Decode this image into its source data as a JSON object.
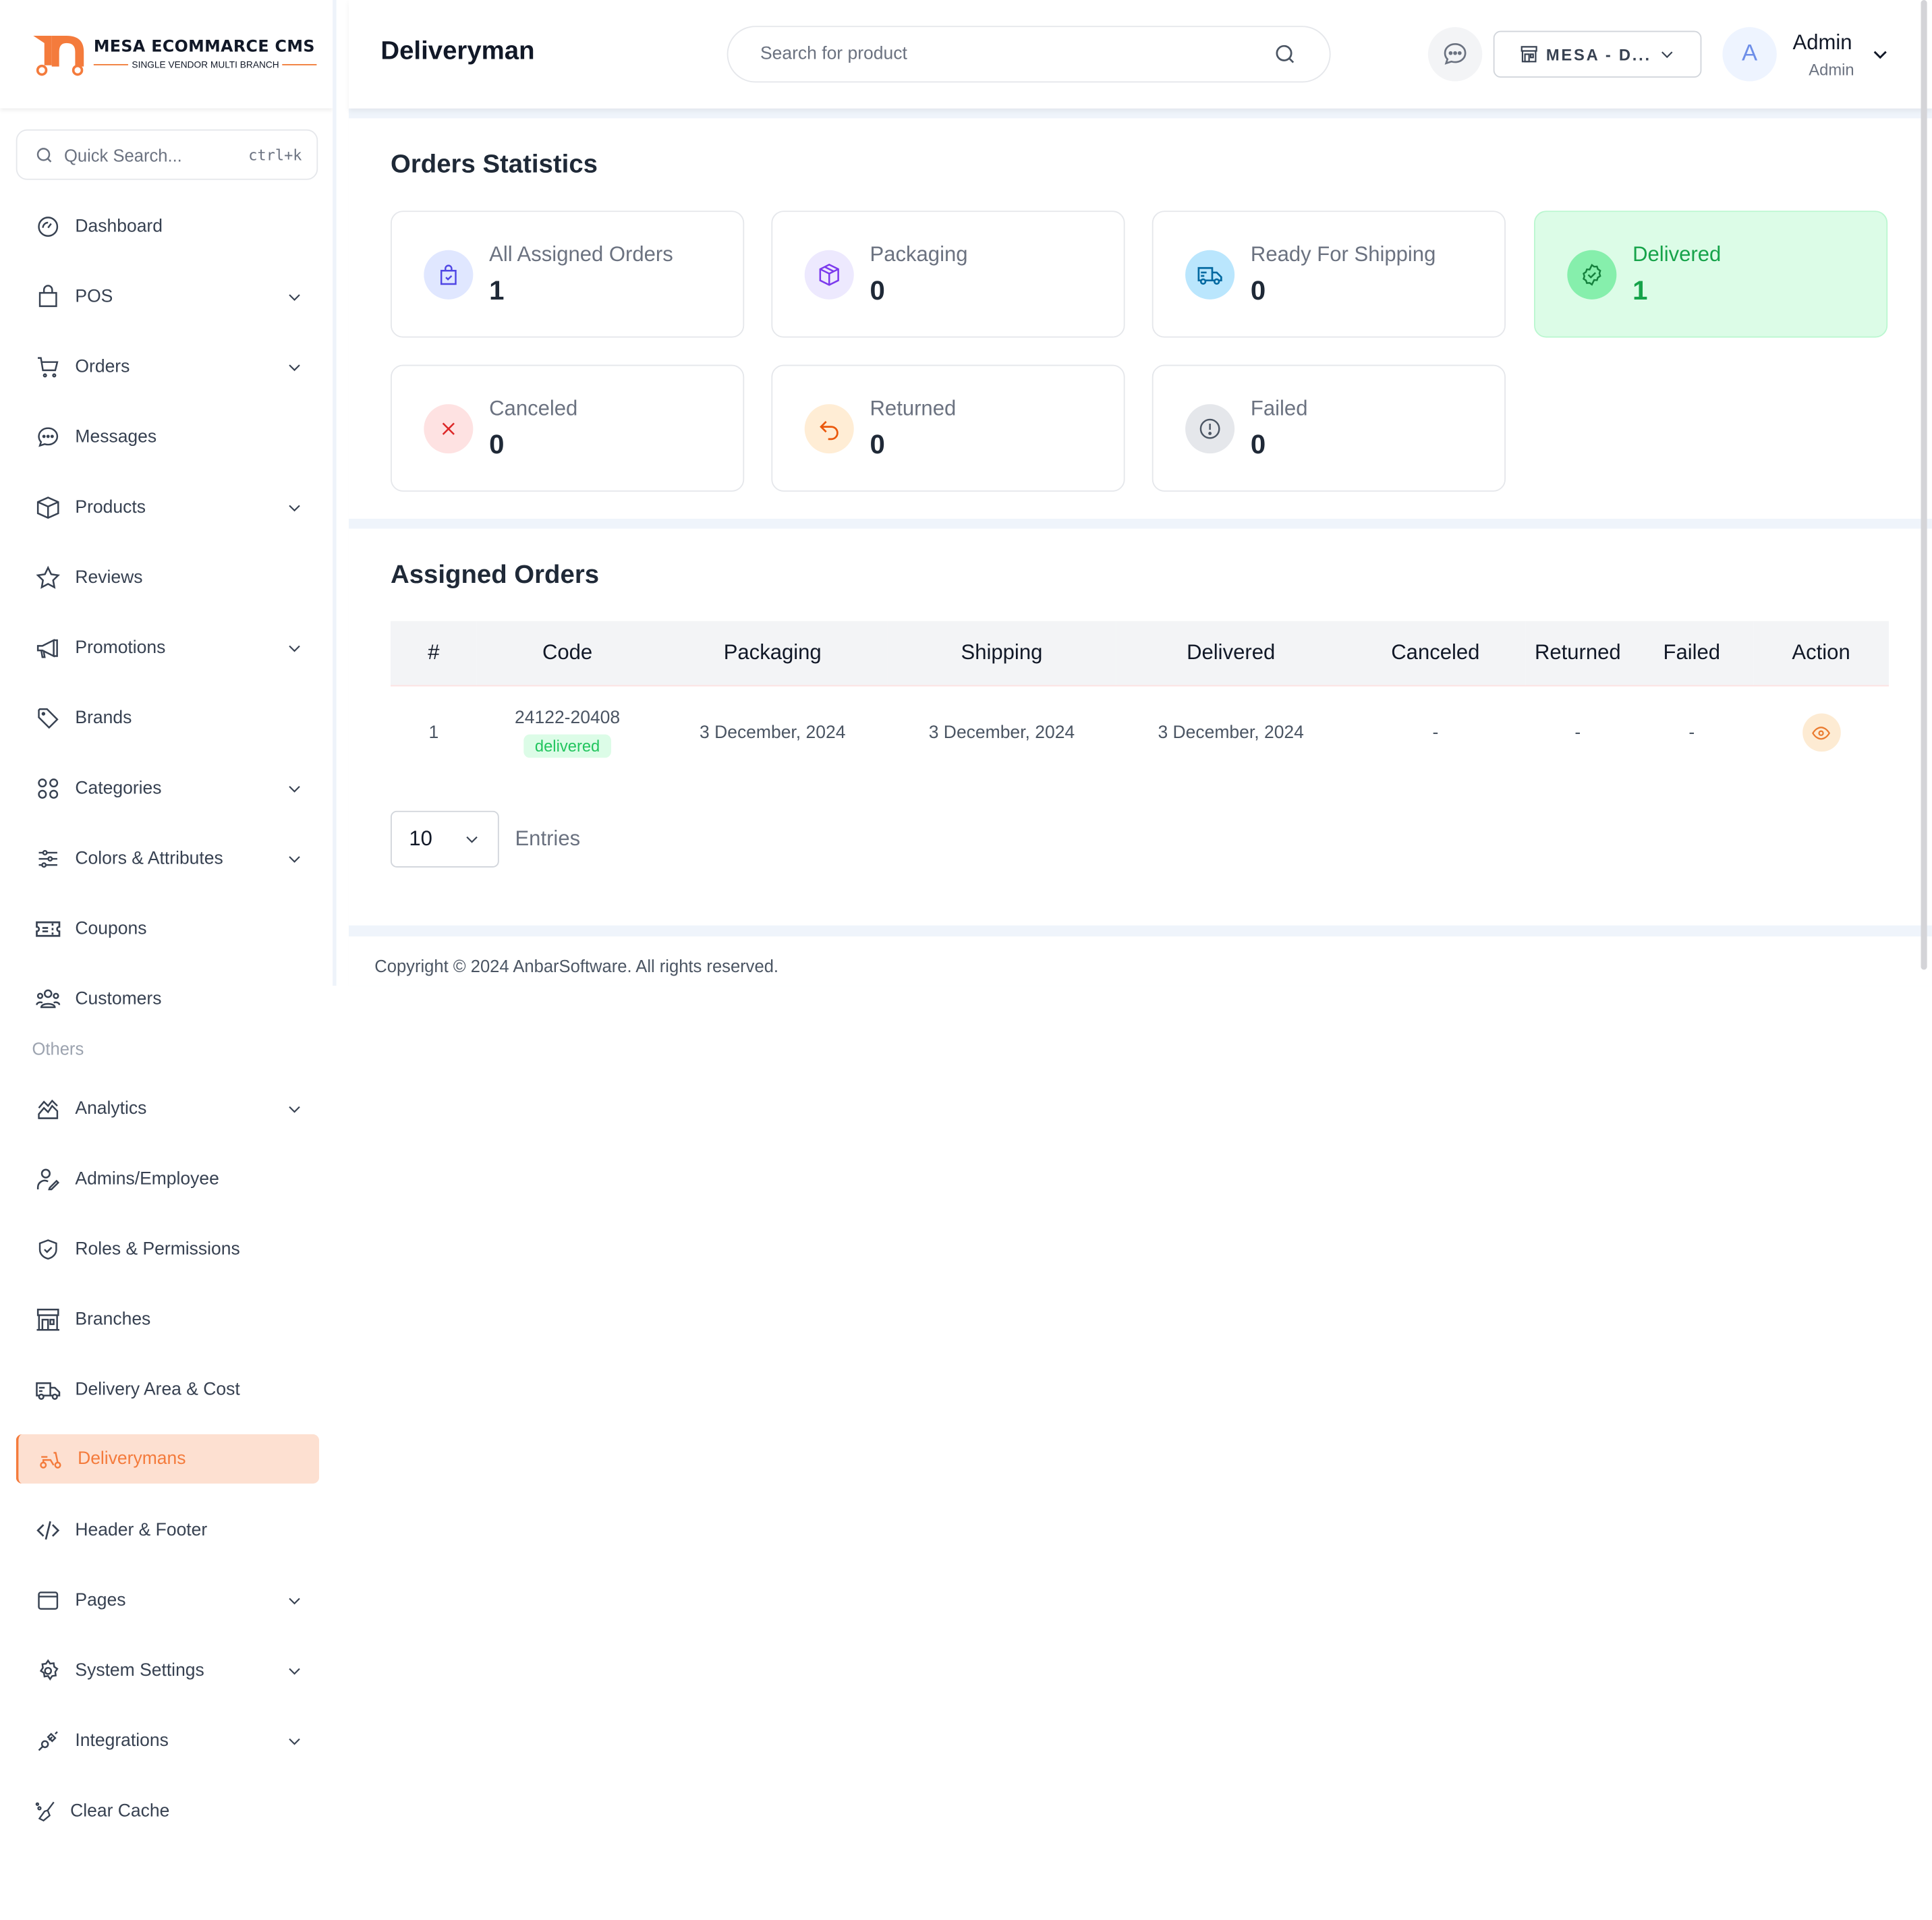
{
  "brand": {
    "title": "MESA ECOMMARCE CMS",
    "subtitle": "SINGLE VENDOR MULTI BRANCH",
    "accent_color": "#f47b3c"
  },
  "sidebar": {
    "quick_search": {
      "placeholder": "Quick Search...",
      "shortcut": "ctrl+k"
    },
    "items": [
      {
        "label": "Dashboard",
        "icon": "dashboard-gauge-icon",
        "expandable": false
      },
      {
        "label": "POS",
        "icon": "shopping-bag-icon",
        "expandable": true
      },
      {
        "label": "Orders",
        "icon": "cart-icon",
        "expandable": true
      },
      {
        "label": "Messages",
        "icon": "chat-bubble-icon",
        "expandable": false
      },
      {
        "label": "Products",
        "icon": "box-icon",
        "expandable": true
      },
      {
        "label": "Reviews",
        "icon": "star-icon",
        "expandable": false
      },
      {
        "label": "Promotions",
        "icon": "megaphone-icon",
        "expandable": true
      },
      {
        "label": "Brands",
        "icon": "tag-icon",
        "expandable": false
      },
      {
        "label": "Categories",
        "icon": "grid-icon",
        "expandable": true
      },
      {
        "label": "Colors & Attributes",
        "icon": "sliders-icon",
        "expandable": true
      },
      {
        "label": "Coupons",
        "icon": "ticket-icon",
        "expandable": false
      },
      {
        "label": "Customers",
        "icon": "users-icon",
        "expandable": false
      }
    ],
    "section_label": "Others",
    "others": [
      {
        "label": "Analytics",
        "icon": "analytics-chart-icon",
        "expandable": true
      },
      {
        "label": "Admins/Employee",
        "icon": "user-edit-icon",
        "expandable": false
      },
      {
        "label": "Roles & Permissions",
        "icon": "shield-check-icon",
        "expandable": false
      },
      {
        "label": "Branches",
        "icon": "store-icon",
        "expandable": false
      },
      {
        "label": "Delivery Area & Cost",
        "icon": "truck-icon",
        "expandable": false
      },
      {
        "label": "Deliverymans",
        "icon": "scooter-icon",
        "expandable": false,
        "active": true
      },
      {
        "label": "Header & Footer",
        "icon": "code-icon",
        "expandable": false
      },
      {
        "label": "Pages",
        "icon": "browser-window-icon",
        "expandable": true
      },
      {
        "label": "System Settings",
        "icon": "gear-icon",
        "expandable": true
      },
      {
        "label": "Integrations",
        "icon": "plug-icon",
        "expandable": true
      },
      {
        "label": "Clear Cache",
        "icon": "broom-icon",
        "expandable": false
      }
    ]
  },
  "header": {
    "page_title": "Deliveryman",
    "search_placeholder": "Search for product",
    "branch_selector": "MESA - D...",
    "user": {
      "initial": "A",
      "name": "Admin",
      "role": "Admin"
    }
  },
  "stats": {
    "title": "Orders Statistics",
    "cards": [
      {
        "label": "All Assigned Orders",
        "value": "1",
        "icon": "bag-check-icon",
        "color": "#4f46e5",
        "bg": "#e0e7ff"
      },
      {
        "label": "Packaging",
        "value": "0",
        "icon": "package-icon",
        "color": "#7c3aed",
        "bg": "#ede9fe"
      },
      {
        "label": "Ready For Shipping",
        "value": "0",
        "icon": "truck-icon",
        "color": "#0369a1",
        "bg": "#bae6fd"
      },
      {
        "label": "Delivered",
        "value": "1",
        "icon": "badge-check-icon",
        "color": "#16a34a",
        "bg": "#86efac",
        "highlight": true
      },
      {
        "label": "Canceled",
        "value": "0",
        "icon": "x-icon",
        "color": "#dc2626",
        "bg": "#fee2e2"
      },
      {
        "label": "Returned",
        "value": "0",
        "icon": "return-arrow-icon",
        "color": "#ea580c",
        "bg": "#ffedd5"
      },
      {
        "label": "Failed",
        "value": "0",
        "icon": "alert-circle-icon",
        "color": "#4b5563",
        "bg": "#e5e7eb"
      }
    ]
  },
  "orders": {
    "title": "Assigned Orders",
    "columns": [
      "#",
      "Code",
      "Packaging",
      "Shipping",
      "Delivered",
      "Canceled",
      "Returned",
      "Failed",
      "Action"
    ],
    "rows": [
      {
        "index": "1",
        "code": "24122-20408",
        "status": "delivered",
        "packaging": "3 December, 2024",
        "shipping": "3 December, 2024",
        "delivered": "3 December, 2024",
        "canceled": "-",
        "returned": "-",
        "failed": "-",
        "action": "view"
      }
    ],
    "page_size": "10",
    "entries_label": "Entries"
  },
  "footer": {
    "copyright": "Copyright © 2024 AnbarSoftware. All rights reserved."
  }
}
